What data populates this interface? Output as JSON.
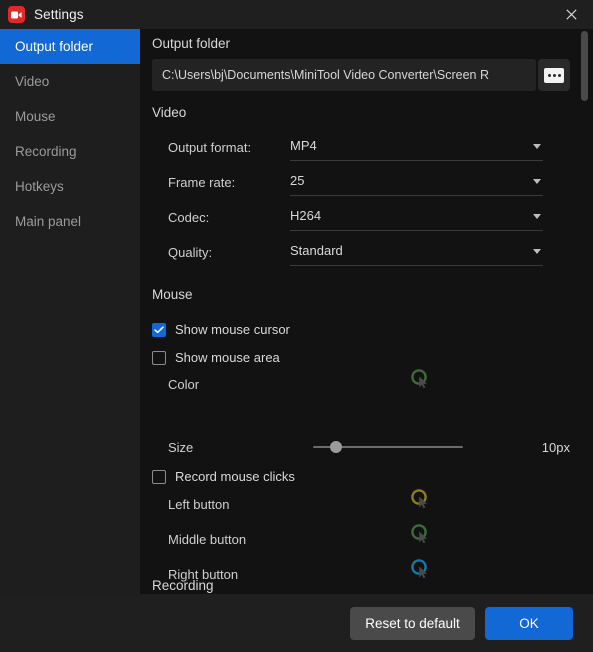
{
  "window": {
    "title": "Settings",
    "app_icon": "video-camera-icon",
    "close_icon": "close-icon",
    "accent_color": "#1268d4",
    "brand_color": "#e02929"
  },
  "sidebar": {
    "items": [
      {
        "label": "Output folder",
        "active": true
      },
      {
        "label": "Video",
        "active": false
      },
      {
        "label": "Mouse",
        "active": false
      },
      {
        "label": "Recording",
        "active": false
      },
      {
        "label": "Hotkeys",
        "active": false
      },
      {
        "label": "Main panel",
        "active": false
      }
    ]
  },
  "content": {
    "output_folder": {
      "section_title": "Output folder",
      "path_value": "C:\\Users\\bj\\Documents\\MiniTool Video Converter\\Screen R",
      "browse_label": "..."
    },
    "video": {
      "section_title": "Video",
      "fields": [
        {
          "label": "Output format:",
          "value": "MP4"
        },
        {
          "label": "Frame rate:",
          "value": "25"
        },
        {
          "label": "Codec:",
          "value": "H264"
        },
        {
          "label": "Quality:",
          "value": "Standard"
        }
      ]
    },
    "mouse": {
      "section_title": "Mouse",
      "show_cursor": {
        "label": "Show mouse cursor",
        "checked": true
      },
      "show_area": {
        "label": "Show mouse area",
        "checked": false
      },
      "color": {
        "label": "Color",
        "swatch_color": "#3f6b3a"
      },
      "size": {
        "label": "Size",
        "value": "10px",
        "percent": 12
      },
      "record_clicks": {
        "label": "Record mouse clicks",
        "checked": false
      },
      "buttons": [
        {
          "label": "Left button",
          "swatch_color": "#8c8118"
        },
        {
          "label": "Middle button",
          "swatch_color": "#3f6b3a"
        },
        {
          "label": "Right button",
          "swatch_color": "#1c74a8"
        }
      ]
    },
    "recording": {
      "section_title": "Recording"
    }
  },
  "footer": {
    "reset_label": "Reset to default",
    "ok_label": "OK"
  }
}
